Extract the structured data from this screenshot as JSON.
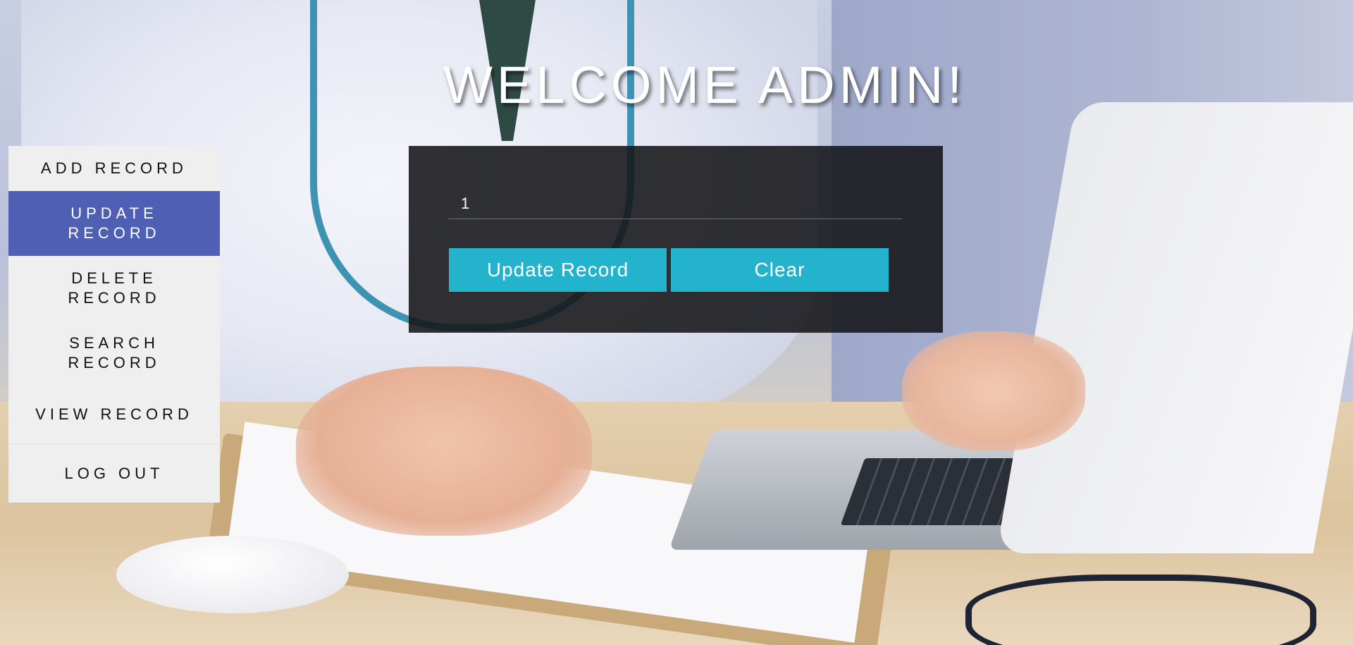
{
  "header": {
    "title": "WELCOME ADMIN!"
  },
  "sidebar": {
    "items": [
      {
        "label": "ADD RECORD",
        "active": false
      },
      {
        "label": "UPDATE RECORD",
        "active": true
      },
      {
        "label": "DELETE RECORD",
        "active": false
      },
      {
        "label": "SEARCH RECORD",
        "active": false
      },
      {
        "label": "VIEW RECORD",
        "active": false
      },
      {
        "label": "LOG OUT",
        "active": false
      }
    ],
    "active_color": "#4f5fb3"
  },
  "form": {
    "record_id_value": "1",
    "update_button_label": "Update Record",
    "clear_button_label": "Clear",
    "button_color": "#23b3cc"
  }
}
